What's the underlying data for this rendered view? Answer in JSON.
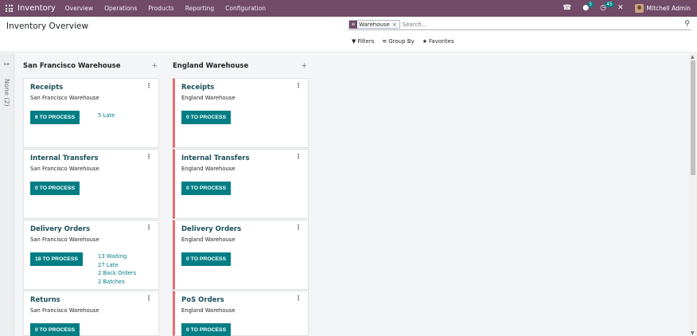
{
  "navbar": {
    "app_name": "Inventory",
    "menu": [
      "Overview",
      "Operations",
      "Products",
      "Reporting",
      "Configuration"
    ],
    "messages_count": "5",
    "activities_count": "45",
    "user_name": "Mitchell Admin"
  },
  "control": {
    "page_title": "Inventory Overview",
    "facet_label": "Warehouse",
    "search_placeholder": "Search...",
    "filters_label": "Filters",
    "group_by_label": "Group By",
    "favorites_label": "Favorites"
  },
  "folded_column": {
    "label": "None (2)"
  },
  "columns": [
    {
      "title": "San Francisco Warehouse",
      "cards": [
        {
          "title": "Receipts",
          "warehouse": "San Francisco Warehouse",
          "button": "6 TO PROCESS",
          "stats": [
            "5 Late"
          ]
        },
        {
          "title": "Internal Transfers",
          "warehouse": "San Francisco Warehouse",
          "button": "0 TO PROCESS",
          "stats": []
        },
        {
          "title": "Delivery Orders",
          "warehouse": "San Francisco Warehouse",
          "button": "18 TO PROCESS",
          "stats": [
            "13 Waiting",
            "27 Late",
            "2 Back Orders",
            "2 Batches"
          ]
        },
        {
          "title": "Returns",
          "warehouse": "San Francisco Warehouse",
          "button": "0 TO PROCESS",
          "stats": []
        }
      ]
    },
    {
      "title": "England Warehouse",
      "cards": [
        {
          "title": "Receipts",
          "warehouse": "England Warehouse",
          "button": "0 TO PROCESS",
          "stats": []
        },
        {
          "title": "Internal Transfers",
          "warehouse": "England Warehouse",
          "button": "0 TO PROCESS",
          "stats": []
        },
        {
          "title": "Delivery Orders",
          "warehouse": "England Warehouse",
          "button": "0 TO PROCESS",
          "stats": []
        },
        {
          "title": "PoS Orders",
          "warehouse": "England Warehouse",
          "button": "0 TO PROCESS",
          "stats": []
        }
      ]
    }
  ],
  "colors": {
    "brand": "#714b67",
    "teal": "#017e84",
    "accent_red": "#e46f6f"
  },
  "icons": {
    "apps": "apps-grid-icon",
    "phone": "phone-icon",
    "chat": "chat-icon",
    "activity": "clock-icon",
    "settings": "tools-icon",
    "search": "magnifier-icon",
    "filter": "funnel-icon",
    "group_by": "layers-icon",
    "favorites": "star-icon"
  }
}
